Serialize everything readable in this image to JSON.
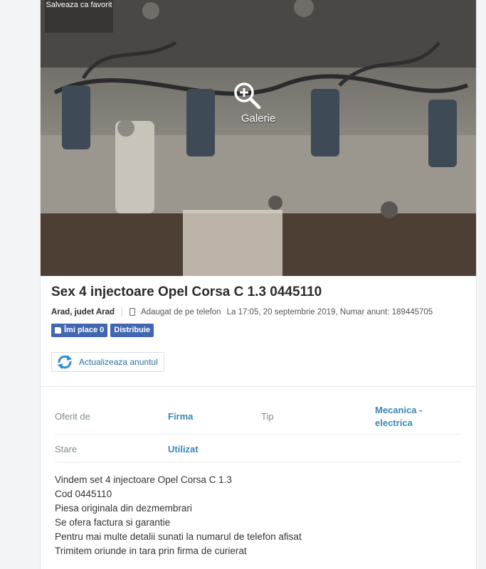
{
  "photo": {
    "favorite_label": "Salveaza ca favorit",
    "gallery_label": "Galerie"
  },
  "ad": {
    "title": "Sex 4 injectoare Opel Corsa C 1.3 0445110",
    "location": "Arad, judet Arad",
    "added_from": "Adaugat de pe telefon",
    "posted": "La 17:05, 20 septembrie 2019, Numar anunt: 189445705"
  },
  "social": {
    "like_label": "Îmi place 0",
    "share_label": "Distribuie"
  },
  "actions": {
    "update_label": "Actualizeaza anuntul"
  },
  "details": [
    {
      "label": "Oferit de",
      "value": "Firma"
    },
    {
      "label": "Tip",
      "value": "Mecanica - electrica"
    },
    {
      "label": "Stare",
      "value": "Utilizat"
    }
  ],
  "description": [
    "Vindem set 4 injectoare Opel Corsa C 1.3",
    "Cod 0445110",
    "Piesa originala din dezmembrari",
    "Se ofera factura si garantie",
    "Pentru mai multe detalii sunati la numarul de telefon afisat",
    "Trimitem oriunde in tara prin firma de curierat"
  ],
  "colors": {
    "link": "#3a87b4",
    "facebook": "#4267b2"
  }
}
